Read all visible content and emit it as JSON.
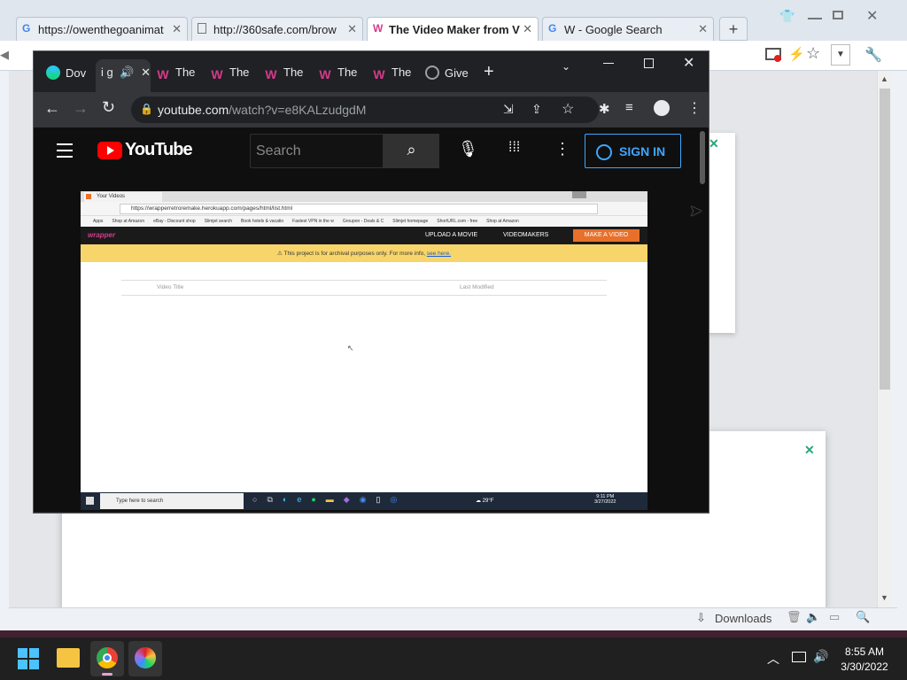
{
  "outer_browser": {
    "tabs": [
      {
        "title": "https://owenthegoanimat",
        "icon": "google-icon",
        "active": false
      },
      {
        "title": "http://360safe.com/brow",
        "icon": "page-icon",
        "active": false
      },
      {
        "title": "The Video Maker from V",
        "icon": "wrapper-w-icon",
        "active": true
      },
      {
        "title": "W - Google Search",
        "icon": "google-icon",
        "active": false
      }
    ],
    "new_tab": "+",
    "status": {
      "downloads": "Downloads"
    },
    "toast_close": "✕"
  },
  "chrome": {
    "tabs": [
      {
        "title": "Dov",
        "icon": "download-app-icon"
      },
      {
        "title": "i g",
        "icon": "speaker-icon",
        "active": true
      },
      {
        "title": "The",
        "icon": "wrapper-w-icon"
      },
      {
        "title": "The",
        "icon": "wrapper-w-icon"
      },
      {
        "title": "The",
        "icon": "wrapper-w-icon"
      },
      {
        "title": "The",
        "icon": "wrapper-w-icon"
      },
      {
        "title": "The",
        "icon": "wrapper-w-icon"
      },
      {
        "title": "Give",
        "icon": "globe-icon"
      }
    ],
    "url_host": "youtube.com",
    "url_path": "/watch?v=e8KALzudgdM"
  },
  "youtube": {
    "logo_text": "YouTube",
    "search_placeholder": "Search",
    "sign_in": "SIGN IN"
  },
  "video": {
    "tab_title": "Your Videos",
    "url": "https://wrapperretroremake.herokuapp.com/pages/html/list.html",
    "bookmarks": [
      "Apps",
      "Shop at Amazon",
      "eBay - Discount shop",
      "Slimjet search",
      "Book hotels & vacatio",
      "Fastest VPN in the w",
      "Groupon - Deals & C",
      "Slimjet homepage",
      "ShortURL.com - free",
      "Shop at Amazon"
    ],
    "site_logo": "wrapper",
    "nav": [
      "UPLOAD A MOVIE",
      "VIDEOMAKERS",
      "MAKE A VIDEO"
    ],
    "banner_text": "This project is for archival purposes only. For more info,",
    "banner_link": "see here.",
    "col_title": "Video Title",
    "col_modified": "Last Modified",
    "taskbar_search": "Type here to search",
    "weather": "29°F",
    "time": "9:11 PM",
    "date": "3/27/2022"
  },
  "taskbar": {
    "time": "8:55 AM",
    "date": "3/30/2022"
  },
  "colors": {
    "youtube_red": "#ff0000",
    "signin_blue": "#3ea6ff",
    "make_video_orange": "#e8702a",
    "banner_yellow": "#f7d56b",
    "wrapper_pink": "#d63a8c"
  }
}
